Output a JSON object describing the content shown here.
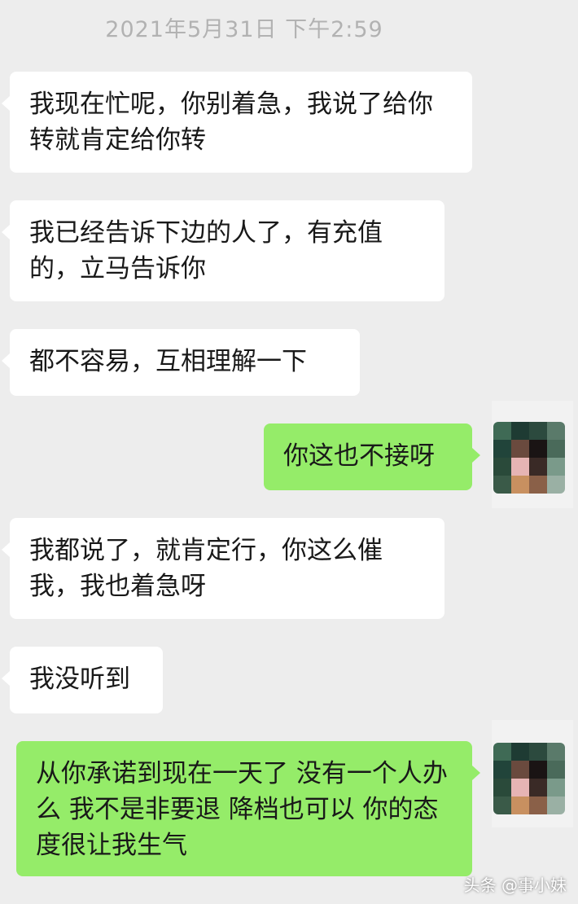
{
  "chat": {
    "timestamp": "2021年5月31日 下午2:59",
    "messages": [
      {
        "side": "in",
        "text": "我现在忙呢，你别着急，我说了给你转就肯定给你转"
      },
      {
        "side": "in",
        "text": "我已经告诉下边的人了，有充值的，立马告诉你"
      },
      {
        "side": "in",
        "text": "都不容易，互相理解一下"
      },
      {
        "side": "out",
        "text": "你这也不接呀"
      },
      {
        "side": "in",
        "text": "我都说了，就肯定行，你这么催我，我也着急呀"
      },
      {
        "side": "in",
        "text": "我没听到"
      },
      {
        "side": "out",
        "text": "从你承诺到现在一天了 没有一个人办么 我不是非要退 降档也可以 你的态度很让我生气"
      }
    ]
  },
  "watermark": "头条 @事小妹",
  "colors": {
    "background": "#ededed",
    "incoming_bubble": "#ffffff",
    "outgoing_bubble": "#95ec69",
    "timestamp_text": "#b2b2b2"
  },
  "avatar_icon": "pixelated-user-avatar"
}
